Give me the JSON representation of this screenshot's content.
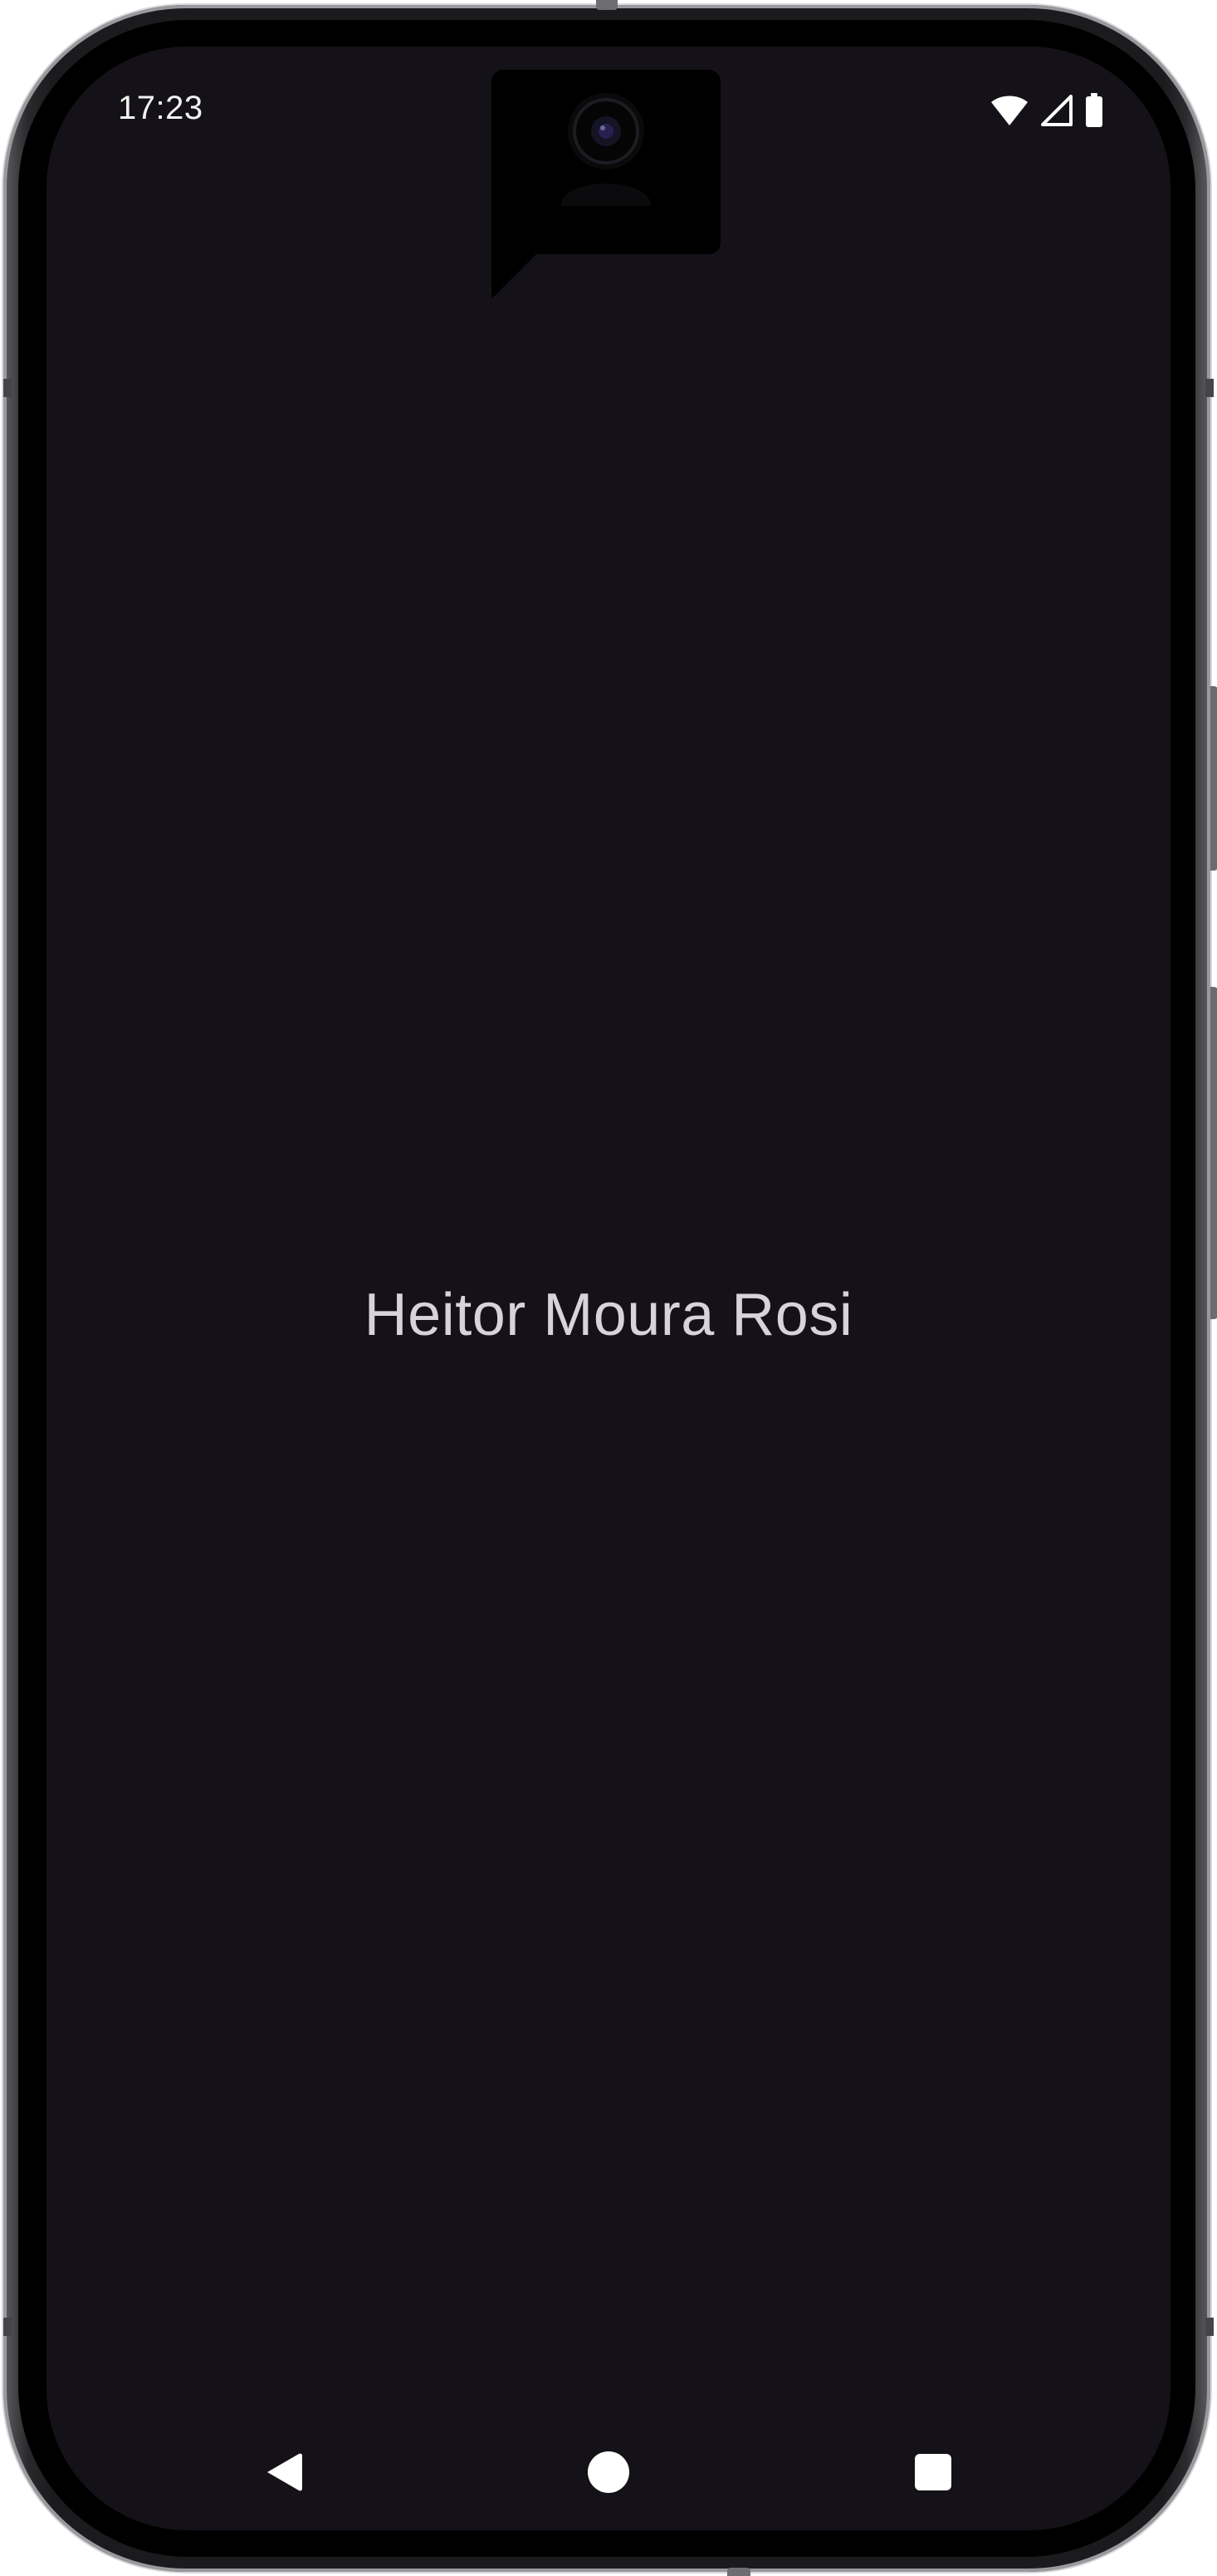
{
  "status_bar": {
    "time": "17:23",
    "icons": [
      "wifi-icon",
      "cellular-signal-icon",
      "battery-icon"
    ]
  },
  "content": {
    "name": "Heitor Moura Rosi"
  },
  "navigation": {
    "buttons": [
      "back-icon",
      "home-icon",
      "recents-icon"
    ]
  },
  "colors": {
    "screen_background": "#141218",
    "name_text": "#d7d2dc",
    "status_text": "#f2f2f2",
    "nav_icons": "#ffffff"
  }
}
